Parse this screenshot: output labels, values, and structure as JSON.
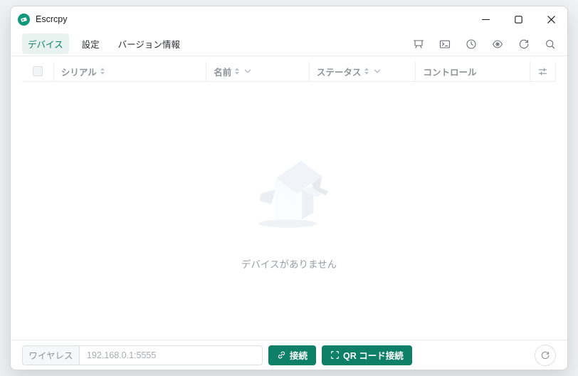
{
  "window": {
    "title": "Escrcpy"
  },
  "titlebar": {
    "controls": [
      {
        "name": "minimize"
      },
      {
        "name": "maximize"
      },
      {
        "name": "close"
      }
    ]
  },
  "tabs": [
    {
      "label": "デバイス",
      "active": true
    },
    {
      "label": "設定",
      "active": false
    },
    {
      "label": "バージョン情報",
      "active": false
    }
  ],
  "toolbar": {
    "icons": [
      "data-board",
      "terminal-window",
      "history-clock",
      "preview-eye",
      "refresh",
      "search"
    ]
  },
  "table": {
    "columns": [
      {
        "label": "",
        "type": "checkbox"
      },
      {
        "label": "シリアル",
        "sortable": true
      },
      {
        "label": "名前",
        "sortable": true,
        "filterable": true
      },
      {
        "label": "ステータス",
        "sortable": true,
        "filterable": true
      },
      {
        "label": "コントロール"
      },
      {
        "label": "",
        "type": "column-settings"
      }
    ],
    "rows": []
  },
  "empty": {
    "message": "デバイスがありません"
  },
  "footer": {
    "wireless_label": "ワイヤレス",
    "address_value": "",
    "address_placeholder": "192.168.0.1:5555",
    "connect_label": "接続",
    "qr_label": "QR コード接続"
  },
  "colors": {
    "primary": "#0f8068",
    "primary_light": "#e8f3ef",
    "header_text": "#909399",
    "border": "#ebeef5",
    "placeholder": "#a8abb2"
  }
}
